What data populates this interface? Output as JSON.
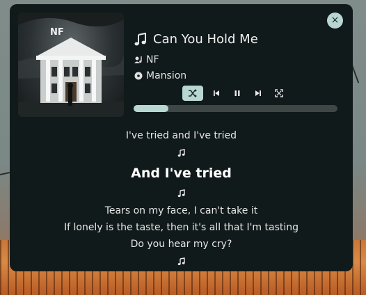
{
  "player": {
    "track_title": "Can You Hold Me",
    "artist": "NF",
    "album": "Mansion",
    "album_art_text": "NF",
    "progress_fraction": 0.17,
    "close_label": "×",
    "controls": [
      "shuffle-icon",
      "previous-icon",
      "pause-icon",
      "next-icon",
      "expand-icon"
    ],
    "accent_color": "#b9d7d2"
  },
  "lyrics": [
    {
      "kind": "line",
      "text": "I've tried and I've tried"
    },
    {
      "kind": "gap"
    },
    {
      "kind": "current",
      "text": "And I've tried"
    },
    {
      "kind": "gap"
    },
    {
      "kind": "line",
      "text": "Tears on my face, I can't take it"
    },
    {
      "kind": "line",
      "text": "If lonely is the taste, then it's all that I'm tasting"
    },
    {
      "kind": "line",
      "text": "Do you hear my cry?"
    },
    {
      "kind": "gap"
    }
  ]
}
